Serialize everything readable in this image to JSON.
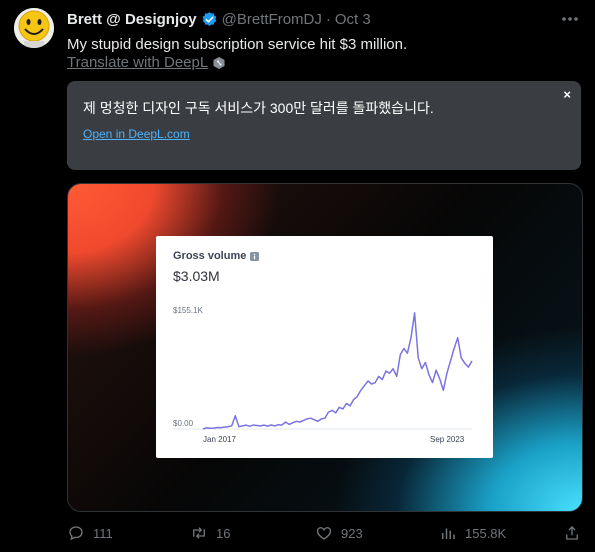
{
  "tweet": {
    "author_name": "Brett @ Designjoy",
    "handle": "@BrettFromDJ",
    "separator": "·",
    "date": "Oct 3",
    "text": "My stupid design subscription service hit $3 million.",
    "translate_label": "Translate with DeepL"
  },
  "translation": {
    "text": "제 멍청한 디자인 구독 서비스가 300만 달러를 돌파했습니다.",
    "link_label": "Open in DeepL.com",
    "close_label": "×"
  },
  "card": {
    "title": "Gross volume",
    "value": "$3.03M"
  },
  "chart_data": {
    "type": "line",
    "title": "Gross volume",
    "x_tick_labels": [
      "Jan 2017",
      "Sep 2023"
    ],
    "y_tick_labels": [
      "$155.1K",
      "$0.00"
    ],
    "ylim": [
      0,
      155.1
    ],
    "grid": false,
    "color": "#7a73e0",
    "series": [
      {
        "name": "",
        "values": [
          0,
          1.5,
          1,
          1.2,
          2,
          1.8,
          2.4,
          3,
          4,
          17,
          3,
          4,
          5,
          3.5,
          5,
          4.5,
          4,
          5,
          3.8,
          5.2,
          4,
          5.5,
          5,
          9,
          6,
          8,
          10,
          9,
          11,
          13,
          14,
          12,
          10,
          13,
          14,
          22,
          24,
          21,
          28,
          26,
          33,
          30,
          38,
          42,
          50,
          56,
          62,
          58,
          60,
          68,
          64,
          75,
          72,
          78,
          68,
          96,
          104,
          98,
          118,
          150,
          92,
          78,
          86,
          70,
          60,
          76,
          65,
          50,
          72,
          88,
          104,
          118,
          92,
          85,
          80,
          88
        ]
      }
    ]
  },
  "actions": {
    "replies": "111",
    "reposts": "16",
    "likes": "923",
    "views": "155.8K"
  },
  "colors": {
    "background": "#000000",
    "verified": "#1d9bf0",
    "link": "#4fb3ff",
    "line": "#7a73e0"
  }
}
